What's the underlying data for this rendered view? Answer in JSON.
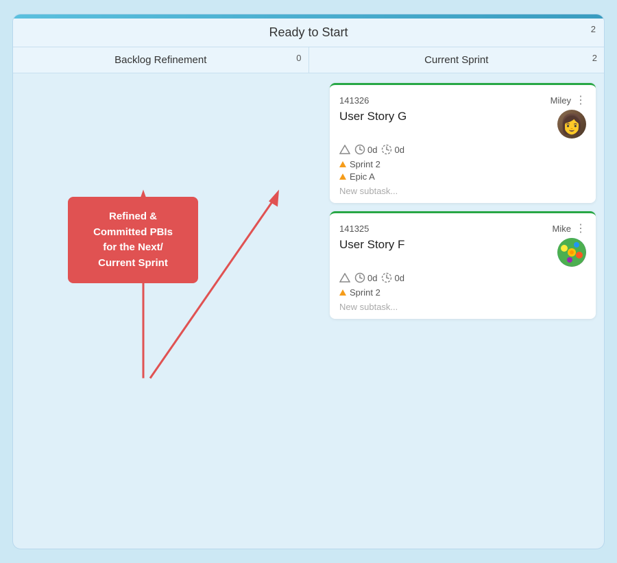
{
  "header": {
    "ready_label": "Ready to Start",
    "ready_badge": "2"
  },
  "columns": [
    {
      "id": "backlog",
      "label": "Backlog Refinement",
      "badge": "0"
    },
    {
      "id": "sprint",
      "label": "Current Sprint",
      "badge": "2"
    }
  ],
  "label_box": {
    "text": "Refined &\nCommitted PBIs\nfor the Next/\nCurrent Sprint"
  },
  "cards": [
    {
      "id": "141326",
      "assignee": "Miley",
      "title": "User Story G",
      "metrics": "0d  0d",
      "sprint": "Sprint 2",
      "epic": "Epic A",
      "has_epic": true,
      "subtask_placeholder": "New subtask...",
      "avatar_type": "miley"
    },
    {
      "id": "141325",
      "assignee": "Mike",
      "title": "User Story F",
      "metrics": "0d  0d",
      "sprint": "Sprint 2",
      "has_epic": false,
      "subtask_placeholder": "New subtask...",
      "avatar_type": "mike"
    }
  ],
  "icons": {
    "menu": "⋮",
    "arrow_up": "↑"
  }
}
